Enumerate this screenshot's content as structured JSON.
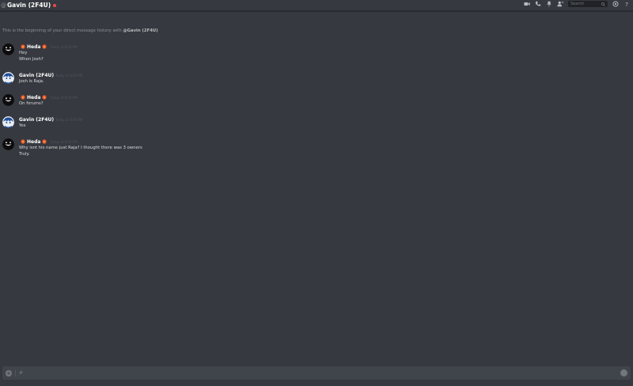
{
  "header": {
    "channel_prefix": "@",
    "title": "Gavin (2F4U)",
    "status_color": "#f04747",
    "icons": [
      "video-call-icon",
      "voice-call-icon",
      "pin-icon",
      "add-user-icon",
      "mention-icon",
      "help-icon"
    ],
    "search": {
      "placeholder": "Search"
    }
  },
  "intro": {
    "text": "This is the beginning of your direct message history with ",
    "mention": "@Gavin (2F4U)"
  },
  "messages": [
    {
      "author": "Heda",
      "time": "Today at 8:03 PM",
      "lines": [
        "Hey",
        "When Josh?"
      ]
    },
    {
      "author": "Gavin (2F4U)",
      "time": "Today at 8:04 PM",
      "lines": [
        "Josh is Raja."
      ]
    },
    {
      "author": "Heda",
      "time": "Today at 8:04 PM",
      "lines": [
        "On forums?"
      ]
    },
    {
      "author": "Gavin (2F4U)",
      "time": "Today at 8:04 PM",
      "lines": [
        "Yes"
      ]
    },
    {
      "author": "Heda",
      "time": "Today at 8:05 PM",
      "lines": [
        "Why isnt his name just Raja? I thought there was 3 owners",
        "Truly."
      ]
    }
  ],
  "composer": {
    "placeholder": "#"
  }
}
